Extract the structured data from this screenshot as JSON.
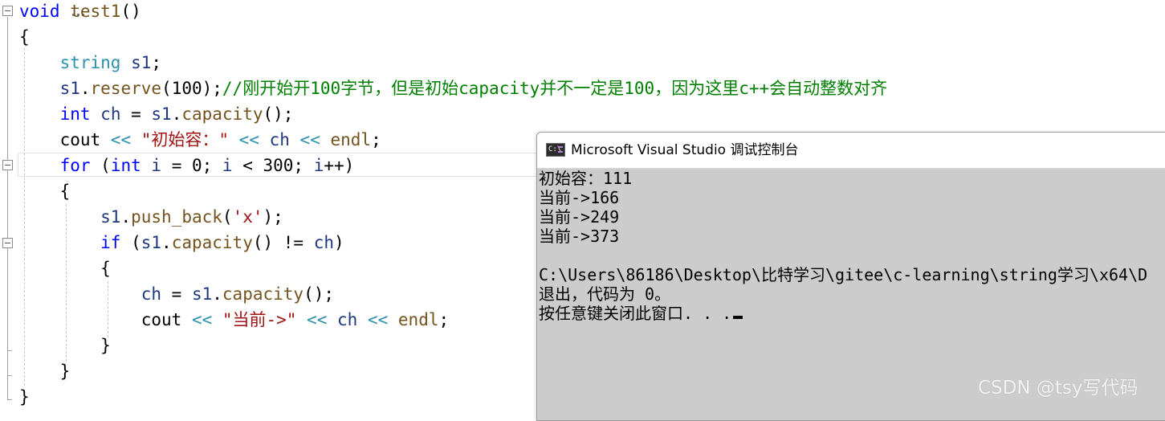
{
  "editor": {
    "lines": [
      {
        "tokens": [
          {
            "t": "void",
            "c": "kw"
          },
          {
            "t": " ",
            "c": "op"
          },
          {
            "t": "test1",
            "c": "fn"
          },
          {
            "t": "()",
            "c": "op"
          }
        ]
      },
      {
        "tokens": [
          {
            "t": "{",
            "c": "op"
          }
        ]
      },
      {
        "tokens": [
          {
            "t": "    ",
            "c": "op"
          },
          {
            "t": "string",
            "c": "ty"
          },
          {
            "t": " ",
            "c": "op"
          },
          {
            "t": "s1",
            "c": "id"
          },
          {
            "t": ";",
            "c": "op"
          }
        ]
      },
      {
        "tokens": [
          {
            "t": "    ",
            "c": "op"
          },
          {
            "t": "s1",
            "c": "id"
          },
          {
            "t": ".",
            "c": "op"
          },
          {
            "t": "reserve",
            "c": "fn"
          },
          {
            "t": "(100);",
            "c": "op"
          },
          {
            "t": "//刚开始开100字节，但是初始capacity并不一定是100，因为这里c++会自动整数对齐",
            "c": "cm"
          }
        ]
      },
      {
        "tokens": [
          {
            "t": "    ",
            "c": "op"
          },
          {
            "t": "int",
            "c": "kw"
          },
          {
            "t": " ",
            "c": "op"
          },
          {
            "t": "ch",
            "c": "id"
          },
          {
            "t": " = ",
            "c": "op"
          },
          {
            "t": "s1",
            "c": "id"
          },
          {
            "t": ".",
            "c": "op"
          },
          {
            "t": "capacity",
            "c": "fn"
          },
          {
            "t": "();",
            "c": "op"
          }
        ]
      },
      {
        "tokens": [
          {
            "t": "    ",
            "c": "op"
          },
          {
            "t": "cout",
            "c": "op"
          },
          {
            "t": " << ",
            "c": "ty"
          },
          {
            "t": "\"初始容：\"",
            "c": "st"
          },
          {
            "t": " << ",
            "c": "ty"
          },
          {
            "t": "ch",
            "c": "id"
          },
          {
            "t": " << ",
            "c": "ty"
          },
          {
            "t": "endl",
            "c": "fn"
          },
          {
            "t": ";",
            "c": "op"
          }
        ]
      },
      {
        "tokens": [
          {
            "t": "    ",
            "c": "op"
          },
          {
            "t": "for",
            "c": "kw"
          },
          {
            "t": " (",
            "c": "op"
          },
          {
            "t": "int",
            "c": "kw"
          },
          {
            "t": " ",
            "c": "op"
          },
          {
            "t": "i",
            "c": "id"
          },
          {
            "t": " = 0; ",
            "c": "op"
          },
          {
            "t": "i",
            "c": "id"
          },
          {
            "t": " < 300; ",
            "c": "op"
          },
          {
            "t": "i",
            "c": "id"
          },
          {
            "t": "++)",
            "c": "op"
          }
        ]
      },
      {
        "tokens": [
          {
            "t": "    {",
            "c": "op"
          }
        ]
      },
      {
        "tokens": [
          {
            "t": "        ",
            "c": "op"
          },
          {
            "t": "s1",
            "c": "id"
          },
          {
            "t": ".",
            "c": "op"
          },
          {
            "t": "push_back",
            "c": "fn"
          },
          {
            "t": "(",
            "c": "op"
          },
          {
            "t": "'x'",
            "c": "st"
          },
          {
            "t": ");",
            "c": "op"
          }
        ]
      },
      {
        "tokens": [
          {
            "t": "        ",
            "c": "op"
          },
          {
            "t": "if",
            "c": "kw"
          },
          {
            "t": " (",
            "c": "op"
          },
          {
            "t": "s1",
            "c": "id"
          },
          {
            "t": ".",
            "c": "op"
          },
          {
            "t": "capacity",
            "c": "fn"
          },
          {
            "t": "() != ",
            "c": "op"
          },
          {
            "t": "ch",
            "c": "id"
          },
          {
            "t": ")",
            "c": "op"
          }
        ]
      },
      {
        "tokens": [
          {
            "t": "        {",
            "c": "op"
          }
        ]
      },
      {
        "tokens": [
          {
            "t": "            ",
            "c": "op"
          },
          {
            "t": "ch",
            "c": "id"
          },
          {
            "t": " = ",
            "c": "op"
          },
          {
            "t": "s1",
            "c": "id"
          },
          {
            "t": ".",
            "c": "op"
          },
          {
            "t": "capacity",
            "c": "fn"
          },
          {
            "t": "();",
            "c": "op"
          }
        ]
      },
      {
        "tokens": [
          {
            "t": "            ",
            "c": "op"
          },
          {
            "t": "cout",
            "c": "op"
          },
          {
            "t": " << ",
            "c": "ty"
          },
          {
            "t": "\"当前->\"",
            "c": "st"
          },
          {
            "t": " << ",
            "c": "ty"
          },
          {
            "t": "ch",
            "c": "id"
          },
          {
            "t": " << ",
            "c": "ty"
          },
          {
            "t": "endl",
            "c": "fn"
          },
          {
            "t": ";",
            "c": "op"
          }
        ]
      },
      {
        "tokens": [
          {
            "t": "        }",
            "c": "op"
          }
        ]
      },
      {
        "tokens": [
          {
            "t": "    }",
            "c": "op"
          }
        ]
      },
      {
        "tokens": [
          {
            "t": "}",
            "c": "op"
          }
        ]
      }
    ]
  },
  "console": {
    "title": "Microsoft Visual Studio 调试控制台",
    "icon_label": "C:\\",
    "output": [
      "初始容：111",
      "当前->166",
      "当前->249",
      "当前->373",
      "",
      "C:\\Users\\86186\\Desktop\\比特学习\\gitee\\c-learning\\string学习\\x64\\D",
      "退出，代码为 0。",
      "按任意键关闭此窗口. . ."
    ]
  },
  "watermark": "CSDN @tsy写代码"
}
